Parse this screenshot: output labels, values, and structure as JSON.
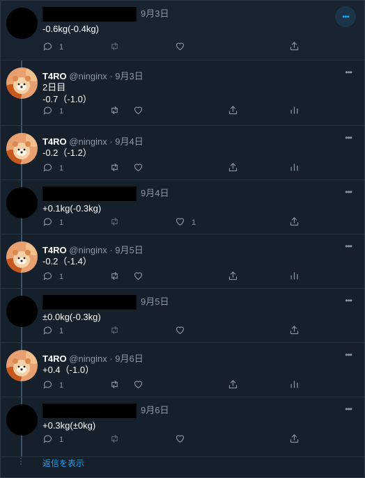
{
  "tweets": [
    {
      "user": "",
      "handle": "",
      "date": "9月3日",
      "lines": [
        "-0.6kg(-0.4kg)"
      ],
      "reply_count": "1",
      "like_count": "",
      "redacted": true,
      "own": false
    },
    {
      "user": "T4RO",
      "handle": "@ninginx",
      "date": "9月3日",
      "lines": [
        "2日目",
        "-0.7（-1.0）"
      ],
      "reply_count": "1",
      "like_count": "",
      "redacted": false,
      "own": true
    },
    {
      "user": "T4RO",
      "handle": "@ninginx",
      "date": "9月4日",
      "lines": [
        "-0.2（-1.2）"
      ],
      "reply_count": "1",
      "like_count": "",
      "redacted": false,
      "own": true
    },
    {
      "user": "",
      "handle": "",
      "date": "9月4日",
      "lines": [
        "+0.1kg(-0.3kg)"
      ],
      "reply_count": "1",
      "like_count": "1",
      "redacted": true,
      "own": false
    },
    {
      "user": "T4RO",
      "handle": "@ninginx",
      "date": "9月5日",
      "lines": [
        "-0.2（-1.4）"
      ],
      "reply_count": "1",
      "like_count": "",
      "redacted": false,
      "own": true
    },
    {
      "user": "",
      "handle": "",
      "date": "9月5日",
      "lines": [
        "±0.0kg(-0.3kg)"
      ],
      "reply_count": "1",
      "like_count": "",
      "redacted": true,
      "own": false
    },
    {
      "user": "T4RO",
      "handle": "@ninginx",
      "date": "9月6日",
      "lines": [
        "+0.4（-1.0）"
      ],
      "reply_count": "1",
      "like_count": "",
      "redacted": false,
      "own": true
    },
    {
      "user": "",
      "handle": "",
      "date": "9月6日",
      "lines": [
        "+0.3kg(±0kg)"
      ],
      "reply_count": "1",
      "like_count": "",
      "redacted": true,
      "own": false
    }
  ],
  "show_replies_label": "返信を表示",
  "more_icon": "more-horizontal-icon",
  "colors": {
    "background": "#15202b",
    "accent": "#1da1f2",
    "muted": "#8899a6"
  }
}
